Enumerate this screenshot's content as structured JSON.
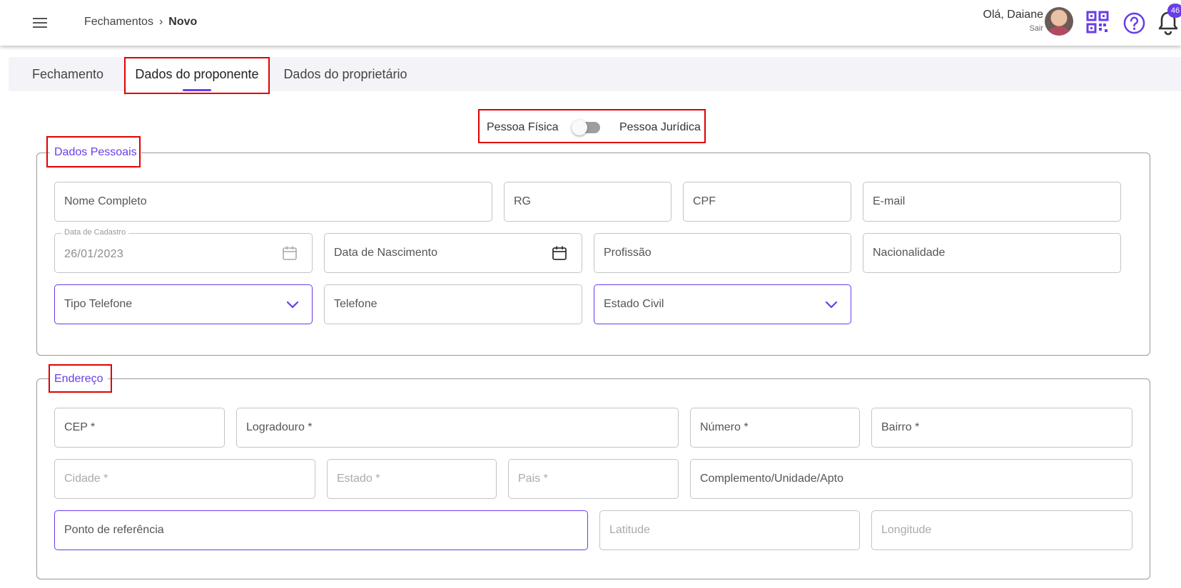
{
  "header": {
    "breadcrumb": [
      "Fechamentos",
      "Novo"
    ],
    "breadcrumb_separator": "›",
    "greeting": "Olá, Daiane",
    "logout_label": "Sair",
    "notification_count": "46"
  },
  "tabs": [
    {
      "label": "Fechamento"
    },
    {
      "label": "Dados do proponente",
      "active": true
    },
    {
      "label": "Dados do proprietário"
    }
  ],
  "person_type": {
    "left_label": "Pessoa Física",
    "right_label": "Pessoa Jurídica",
    "selected": "Pessoa Física"
  },
  "personal_data": {
    "legend": "Dados Pessoais",
    "full_name": "Nome Completo",
    "rg": "RG",
    "cpf": "CPF",
    "email": "E-mail",
    "registration_date_label": "Data de Cadastro",
    "registration_date_value": "26/01/2023",
    "birth_date": "Data de Nascimento",
    "profession": "Profissão",
    "nationality": "Nacionalidade",
    "phone_type": "Tipo Telefone",
    "phone": "Telefone",
    "marital_status": "Estado Civil"
  },
  "address": {
    "legend": "Endereço",
    "cep": "CEP *",
    "street": "Logradouro *",
    "number": "Número *",
    "district": "Bairro *",
    "city": "Cidade *",
    "state": "Estado *",
    "country": "Pais *",
    "complement": "Complemento/Unidade/Apto",
    "reference": "Ponto de referência",
    "latitude": "Latitude",
    "longitude": "Longitude"
  },
  "colors": {
    "accent": "#6a3de8",
    "highlight_box": "#e00000",
    "border": "#c4c4c4"
  }
}
